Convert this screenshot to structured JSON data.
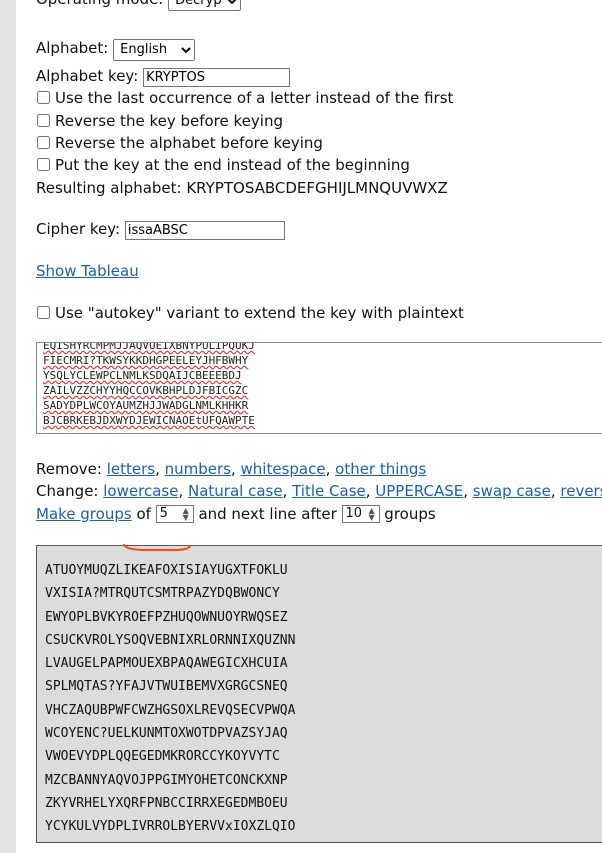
{
  "operating_mode": {
    "label": "Operating mode:",
    "value": "Decrypt"
  },
  "alphabet": {
    "label": "Alphabet:",
    "value": "English"
  },
  "alphabet_key": {
    "label": "Alphabet key:",
    "value": "KRYPTOS"
  },
  "options": [
    {
      "label": "Use the last occurrence of a letter instead of the first",
      "checked": false
    },
    {
      "label": "Reverse the key before keying",
      "checked": false
    },
    {
      "label": "Reverse the alphabet before keying",
      "checked": false
    },
    {
      "label": "Put the key at the end instead of the beginning",
      "checked": false
    }
  ],
  "resulting_alphabet": "Resulting alphabet: KRYPTOSABCDEFGHIJLMNQUVWXZ",
  "cipher_key": {
    "label": "Cipher key:",
    "value": "issaABSC"
  },
  "show_tableau": "Show Tableau",
  "autokey": {
    "label": "Use \"autokey\" variant to extend the key with plaintext",
    "checked": false
  },
  "input_text": "EQISHYRCMPMJJAQVUEIXBNYPULIPQUKJ\nFIECMRI?TKWSYKKDHGPEELEYJHFBWHY\nYSQLYCLEWPCLNMLKSDQAIJCBEEEBDJ\nZAILVZZCHYYHQCCOVKBHPLDJFBICGZC\nSADYDPLWCOYAUMZHJJWADGLNMLKHHKR\nBJCBRKEBJDXWYDJEWICNAOEtUFQAWPTE",
  "remove": {
    "label": "Remove: ",
    "links": [
      "letters",
      "numbers",
      "whitespace",
      "other things"
    ]
  },
  "change": {
    "label": "Change: ",
    "links": [
      "lowercase",
      "Natural case",
      "Title Case",
      "UPPERCASE",
      "swap case",
      "reverse"
    ]
  },
  "groups": {
    "link": "Make groups",
    "of": " of ",
    "size": "5",
    "next_line": " and next line after ",
    "count": "10",
    "suffix": " groups"
  },
  "output_lines": [
    "ATUOYMUQZLIKEAFOXISIAYUGXTFOKLU",
    "VXISIA?MTRQUTCSMTRPAZYDQBWONCY",
    "EWYOPLBVKYROEFPZHUQOWNUOYRWQSEZ",
    "CSUCKVROLYSOQVEBNIXRLORNNIXQUZNN",
    "LVAUGELPAPMOUEXBPAQAWEGICXHCUIA",
    "SPLMQTAS?YFAJVTWUIBEMVXGRGCSNEQ",
    "VHCZAQUBPWFCWZHGSOXLREVQSECVPWQA",
    "WCOYENC?UELKUNMTOXWOTDPVAZSYJAQ",
    "VWOEVYDPLQQEGEDMKRORCCYKOYVYTC",
    "MZCBANNYAQVOJPPGIMYOHETCONCKXNP",
    "ZKYVRHELYXQRFPNBCCIRRXEGEDMBOEU",
    "YCYKULVYDPLIVRROLBYERVVxIOXZLQIO"
  ],
  "colors": {
    "link": "#1a5fb4",
    "output_bg": "#dcdcdc",
    "annotation": "#e8561c"
  }
}
